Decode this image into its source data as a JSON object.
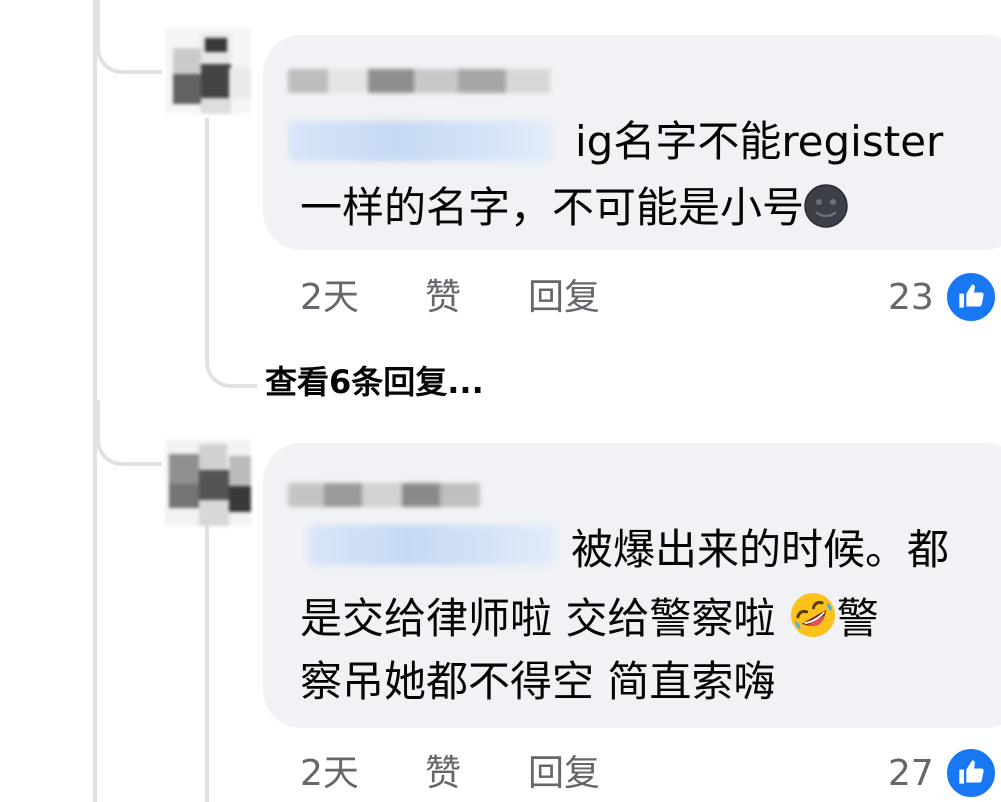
{
  "comments": [
    {
      "body_lines": [
        "ig名字不能register",
        "一样的名字，不可能是小号"
      ],
      "emoji": "new-moon-face",
      "time": "2天",
      "like_label": "赞",
      "reply_label": "回复",
      "reaction_count": "23",
      "view_replies": "查看6条回复..."
    },
    {
      "body_lines": [
        "被爆出来的时候。都",
        "是交给律师啦 交给警察啦",
        "察吊她都不得空 简直索嗨"
      ],
      "line2_tail": "警",
      "emoji": "rolling-on-floor-laughing",
      "time": "2天",
      "like_label": "赞",
      "reply_label": "回复",
      "reaction_count": "27"
    }
  ],
  "colors": {
    "bubble": "#f0f2f5",
    "text": "#050505",
    "meta": "#65676b",
    "like": "#1877f2",
    "thread": "#dfe1e5"
  }
}
